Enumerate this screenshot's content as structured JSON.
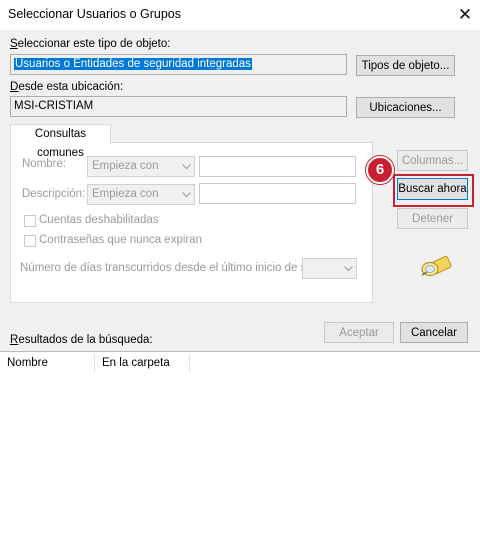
{
  "window": {
    "title": "Seleccionar Usuarios o Grupos",
    "close_label": "✕"
  },
  "object_type": {
    "label": "Seleccionar este tipo de objeto:",
    "value": "Usuarios o Entidades de seguridad integradas",
    "button": "Tipos de objeto..."
  },
  "location": {
    "label": "Desde esta ubicación:",
    "value": "MSI-CRISTIAM",
    "button": "Ubicaciones..."
  },
  "tab": {
    "label": "Consultas comunes"
  },
  "query": {
    "name_label": "Nombre:",
    "name_combo": "Empieza con",
    "description_label": "Descripción:",
    "description_combo": "Empieza con",
    "disabled_accounts": "Cuentas deshabilitadas",
    "nonexpiring_passwords": "Contraseñas que nunca expiran",
    "days_label": "Número de días transcurridos desde el último inicio de sesión:"
  },
  "side_buttons": {
    "columns": "Columnas...",
    "search_now": "Buscar ahora",
    "stop": "Detener"
  },
  "annotation": {
    "step_number": "6",
    "color": "#c8202f"
  },
  "actions": {
    "accept": "Aceptar",
    "cancel": "Cancelar"
  },
  "results": {
    "label": "Resultados de la búsqueda:",
    "columns": [
      "Nombre",
      "En la carpeta"
    ]
  },
  "icons": {
    "close": "close-icon",
    "search": "search-people-icon",
    "dropdown": "chevron-down-icon"
  }
}
